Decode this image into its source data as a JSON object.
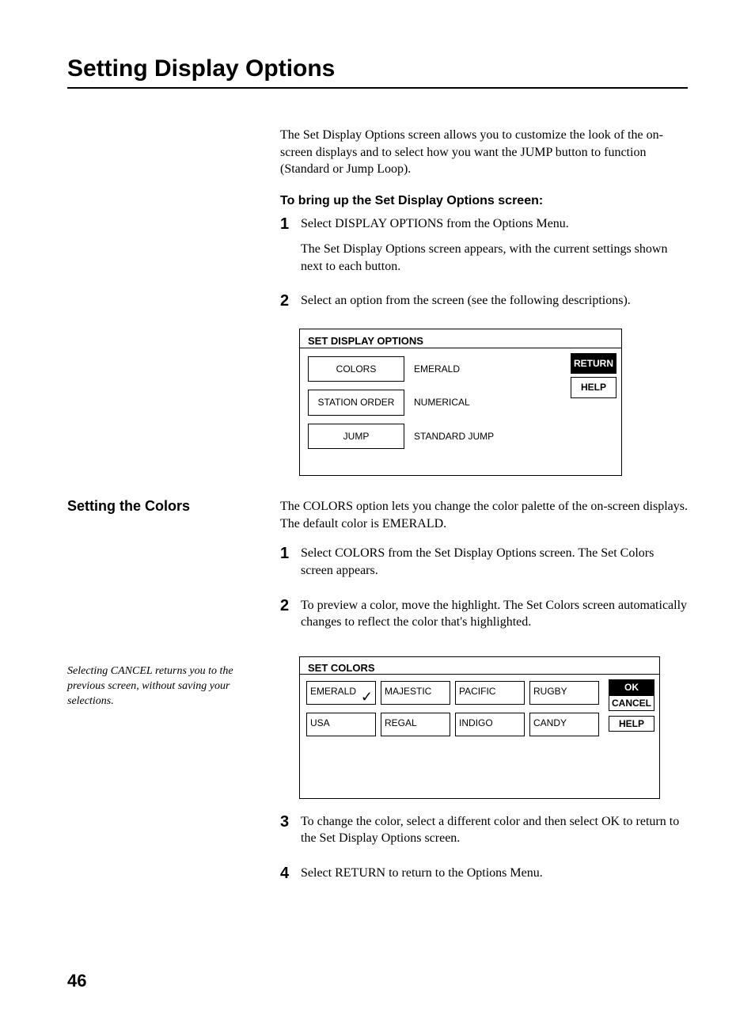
{
  "title": "Setting Display Options",
  "intro": "The Set Display Options screen allows you to customize the look of the on-screen displays and to select how you want the JUMP button to function (Standard or Jump Loop).",
  "subhead1": "To bring up the Set Display Options screen:",
  "step1_a": "Select DISPLAY OPTIONS from the Options Menu.",
  "step1_b": "The Set Display Options screen appears, with the current settings shown next to each button.",
  "step2": "Select an option from the screen (see the following descriptions).",
  "screen1": {
    "title": "SET DISPLAY OPTIONS",
    "rows": [
      {
        "label": "COLORS",
        "value": "EMERALD"
      },
      {
        "label": "STATION ORDER",
        "value": "NUMERICAL"
      },
      {
        "label": "JUMP",
        "value": "STANDARD JUMP"
      }
    ],
    "return": "RETURN",
    "help": "HELP"
  },
  "side_heading": "Setting the Colors",
  "colors_intro": "The COLORS option lets you change the color palette of the on-screen displays. The default color is EMERALD.",
  "cstep1": "Select COLORS from the Set Display Options screen. The Set Colors screen appears.",
  "cstep2": "To preview a color, move the highlight. The Set Colors screen automatically changes to reflect the color that's highlighted.",
  "side_note": "Selecting CANCEL returns you to the previous screen, without saving your selections.",
  "screen2": {
    "title": "SET COLORS",
    "colors_row1": [
      "EMERALD",
      "MAJESTIC",
      "PACIFIC",
      "RUGBY"
    ],
    "colors_row2": [
      "USA",
      "REGAL",
      "INDIGO",
      "CANDY"
    ],
    "ok": "OK",
    "cancel": "CANCEL",
    "help": "HELP"
  },
  "cstep3": "To change the color, select a different color and then select OK to return to the Set Display Options screen.",
  "cstep4": "Select RETURN to return to the Options Menu.",
  "page_number": "46",
  "nums": {
    "n1": "1",
    "n2": "2",
    "n3": "3",
    "n4": "4"
  }
}
